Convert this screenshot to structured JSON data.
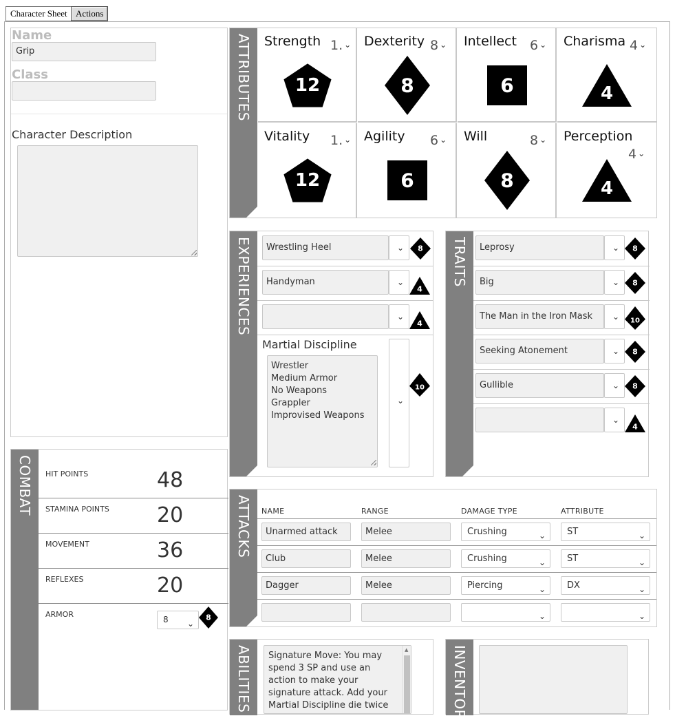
{
  "tabs": [
    {
      "label": "Character Sheet"
    },
    {
      "label": "Actions"
    }
  ],
  "profile": {
    "name_label": "Name",
    "name_value": "Grip",
    "class_label": "Class",
    "class_value": "",
    "description_label": "Character Description",
    "description_value": ""
  },
  "attributes": {
    "title": "ATTRIBUTES",
    "items": [
      {
        "name": "Strength",
        "selected": "1.",
        "die": "12",
        "shape": "pentagon"
      },
      {
        "name": "Dexterity",
        "selected": "8",
        "die": "8",
        "shape": "diamond"
      },
      {
        "name": "Intellect",
        "selected": "6",
        "die": "6",
        "shape": "square"
      },
      {
        "name": "Charisma",
        "selected": "4",
        "die": "4",
        "shape": "triangle"
      },
      {
        "name": "Vitality",
        "selected": "1.",
        "die": "12",
        "shape": "pentagon"
      },
      {
        "name": "Agility",
        "selected": "6",
        "die": "6",
        "shape": "square"
      },
      {
        "name": "Will",
        "selected": "8",
        "die": "8",
        "shape": "diamond"
      },
      {
        "name": "Perception",
        "selected": "4",
        "die": "4",
        "shape": "triangle"
      }
    ]
  },
  "experiences": {
    "title": "EXPERIENCES",
    "items": [
      {
        "value": "Wrestling Heel",
        "die": "8",
        "shape": "diamond"
      },
      {
        "value": "Handyman",
        "die": "4",
        "shape": "triangle"
      },
      {
        "value": "",
        "die": "4",
        "shape": "triangle"
      }
    ],
    "martial": {
      "label": "Martial Discipline",
      "lines": [
        "Wrestler",
        "Medium Armor",
        "No Weapons",
        "Grappler",
        "Improvised Weapons"
      ],
      "die": "10",
      "shape": "kite"
    }
  },
  "traits": {
    "title": "TRAITS",
    "items": [
      {
        "value": "Leprosy",
        "die": "8",
        "shape": "diamond"
      },
      {
        "value": "Big",
        "die": "8",
        "shape": "diamond"
      },
      {
        "value": "The Man in the Iron Mask",
        "die": "10",
        "shape": "kite"
      },
      {
        "value": "Seeking Atonement",
        "die": "8",
        "shape": "diamond"
      },
      {
        "value": "Gullible",
        "die": "8",
        "shape": "diamond"
      },
      {
        "value": "",
        "die": "4",
        "shape": "triangle"
      }
    ]
  },
  "combat": {
    "title": "COMBAT",
    "rows": [
      {
        "label": "HIT POINTS",
        "value": "48"
      },
      {
        "label": "STAMINA POINTS",
        "value": "20"
      },
      {
        "label": "MOVEMENT",
        "value": "36"
      },
      {
        "label": "REFLEXES",
        "value": "20"
      }
    ],
    "armor": {
      "label": "ARMOR",
      "selected": "8",
      "die": "8",
      "shape": "diamond"
    }
  },
  "attacks": {
    "title": "ATTACKS",
    "headers": [
      "NAME",
      "RANGE",
      "DAMAGE TYPE",
      "ATTRIBUTE"
    ],
    "rows": [
      {
        "name": "Unarmed attack",
        "range": "Melee",
        "damage": "Crushing",
        "attribute": "ST"
      },
      {
        "name": "Club",
        "range": "Melee",
        "damage": "Crushing",
        "attribute": "ST"
      },
      {
        "name": "Dagger",
        "range": "Melee",
        "damage": "Piercing",
        "attribute": "DX"
      },
      {
        "name": "",
        "range": "",
        "damage": "",
        "attribute": ""
      }
    ]
  },
  "abilities": {
    "title": "ABILITIES",
    "text": "Signature Move: You may spend 3 SP and use an action to make your signature attack. Add your Martial Discipline die twice to your attack roll."
  },
  "inventory": {
    "title": "INVENTORY",
    "text": ""
  },
  "colors": {
    "sidebar": "#808080",
    "die_fill": "#000000",
    "border": "#c8c8c8",
    "input_bg": "#f0f0f0"
  }
}
